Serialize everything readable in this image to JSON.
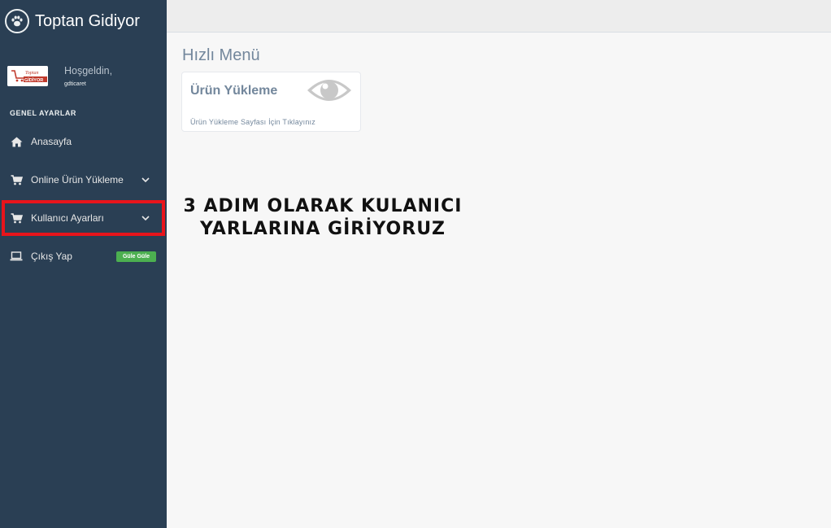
{
  "brand": {
    "title": "Toptan Gidiyor",
    "icon": "paw-icon"
  },
  "profile": {
    "logo_line1": "Toptan",
    "logo_line2": "GİDİYOR",
    "welcome": "Hoşgeldin,",
    "username": "gdticaret"
  },
  "sidebar": {
    "section_title": "GENEL AYARLAR",
    "items": [
      {
        "label": "Anasayfa",
        "icon": "home-icon"
      },
      {
        "label": "Online Ürün Yükleme",
        "icon": "cart-icon"
      },
      {
        "label": "Kullanıcı Ayarları",
        "icon": "cart-icon"
      },
      {
        "label": "Çıkış Yap",
        "icon": "laptop-icon"
      }
    ],
    "logout_badge": "Güle Güle"
  },
  "main": {
    "page_title": "Hızlı Menü",
    "tile": {
      "title": "Ürün Yükleme",
      "subtitle": "Ürün Yükleme Sayfası İçin Tıklayınız",
      "icon": "eye-icon"
    },
    "annotation_line1": "3 ADIM OLARAK KULANICI",
    "annotation_line2": "YARLARINA GİRİYORUZ"
  },
  "colors": {
    "sidebar_bg": "#2a3f54",
    "highlight": "#e8141b",
    "badge": "#4caf50",
    "content_bg": "#f7f7f7"
  }
}
